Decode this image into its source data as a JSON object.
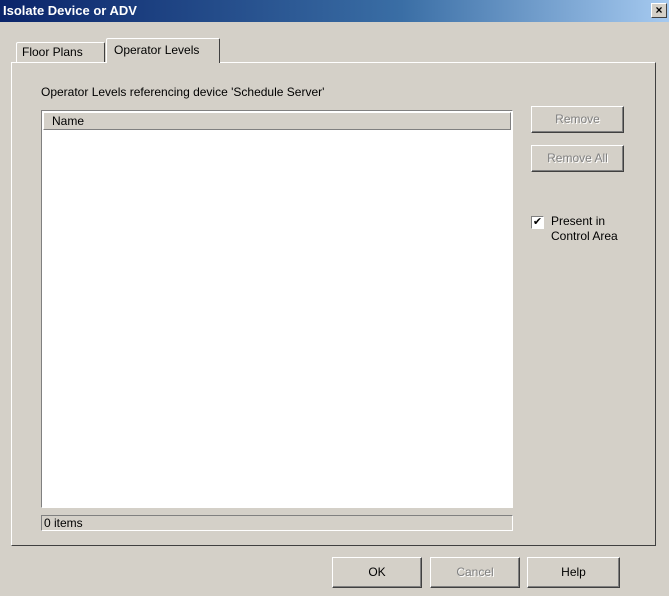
{
  "window": {
    "title": "Isolate Device or ADV",
    "close_label": "×"
  },
  "tabs": [
    {
      "label": "Floor Plans",
      "active": false
    },
    {
      "label": "Operator Levels",
      "active": true
    }
  ],
  "panel": {
    "label": "Operator Levels referencing device 'Schedule Server'",
    "list": {
      "columns": [
        "Name"
      ],
      "rows": []
    },
    "status": "0 items",
    "buttons": {
      "remove": "Remove",
      "remove_all": "Remove All"
    },
    "present_in_control_area": {
      "checked": true,
      "check_mark": "✔",
      "label_line1": "Present in",
      "label_line2": "Control Area"
    }
  },
  "footer": {
    "ok": "OK",
    "cancel": "Cancel",
    "help": "Help"
  }
}
